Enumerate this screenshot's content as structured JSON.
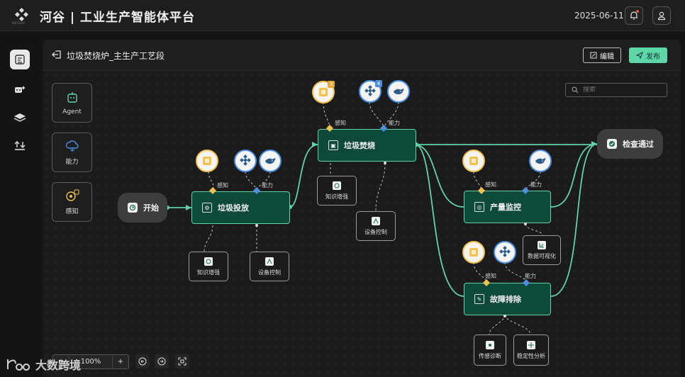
{
  "app": {
    "title": "河谷 | 工业生产智能体平台",
    "logo_text": "HEGUAI"
  },
  "header": {
    "date": "2025-06-11",
    "notification_icon": "bell-icon",
    "user_icon": "user-icon"
  },
  "sidebar": {
    "items": [
      {
        "icon": "workflow-icon",
        "active": true
      },
      {
        "icon": "robot-sparkle-icon",
        "active": false
      },
      {
        "icon": "layers-icon",
        "active": false
      },
      {
        "icon": "upload-sort-icon",
        "active": false
      }
    ]
  },
  "page": {
    "title": "垃圾焚烧炉_主生产工艺段",
    "edit_label": "编辑",
    "publish_label": "发布"
  },
  "search": {
    "placeholder": "搜索"
  },
  "palette": [
    {
      "label": "Agent",
      "icon": "agent-icon"
    },
    {
      "label": "能力",
      "icon": "cloud-brain-icon"
    },
    {
      "label": "感知",
      "icon": "perception-icon"
    }
  ],
  "flow": {
    "start": "开始",
    "end": "检查通过",
    "nodes": [
      {
        "id": "n1",
        "label": "垃圾投放"
      },
      {
        "id": "n2",
        "label": "垃圾焚烧"
      },
      {
        "id": "n3",
        "label": "产量监控"
      },
      {
        "id": "n4",
        "label": "故障排除"
      }
    ],
    "edge_labels": {
      "perception": "感知",
      "capability": "能力"
    },
    "badges": {
      "n2_perception": "3",
      "n2_capability": "4"
    },
    "sub_nodes": {
      "n1_a": "知识增强",
      "n1_b": "设备控制",
      "n2_a": "知识增强",
      "n2_b": "设备控制",
      "n3_a": "数据可视化",
      "n4_a": "传感诊断",
      "n4_b": "稳定性分析"
    }
  },
  "toolbar": {
    "zoom": "100%",
    "zoom_out": "−",
    "zoom_in": "+"
  },
  "watermark": "大数跨境",
  "colors": {
    "accent": "#5fd6a8",
    "node_bg": "#0e4a3a",
    "perception": "#f2c14e",
    "capability": "#4d8ee0"
  }
}
